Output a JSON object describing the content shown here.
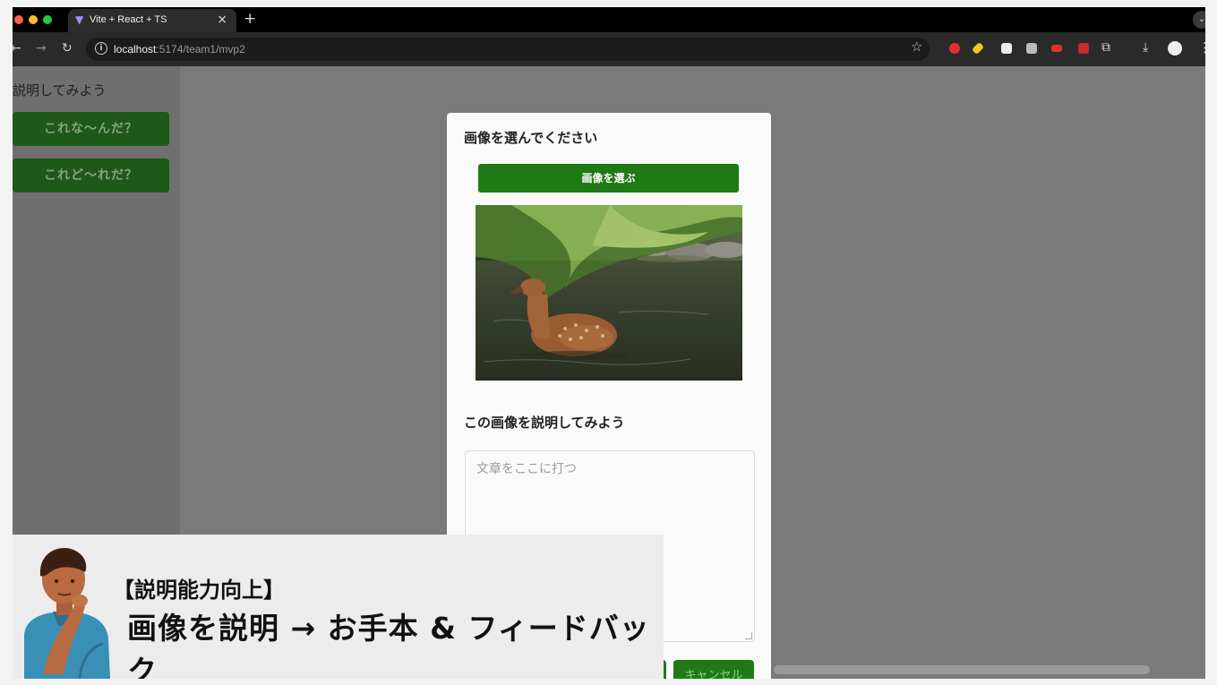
{
  "browser": {
    "tab_title": "Vite + React + TS",
    "tab_close": "×",
    "new_tab": "+",
    "url_host": "localhost",
    "url_path": ":5174/team1/mvp2"
  },
  "sidebar": {
    "title": "説明してみよう",
    "items": [
      {
        "label": "これな〜んだ？"
      },
      {
        "label": "これど〜れだ？"
      }
    ]
  },
  "modal": {
    "heading_image": "画像を選んでください",
    "choose_button": "画像を選ぶ",
    "heading_describe": "この画像を説明してみよう",
    "textarea_placeholder": "文章をここに打つ",
    "cancel_button": "キャンセル"
  },
  "overlay": {
    "caption_line1": "【説明能力向上】",
    "caption_line2": "画像を説明 → お手本 & フィードバック"
  },
  "colors": {
    "primary_green": "#1f7a16",
    "backdrop": "#7a7a7a"
  }
}
